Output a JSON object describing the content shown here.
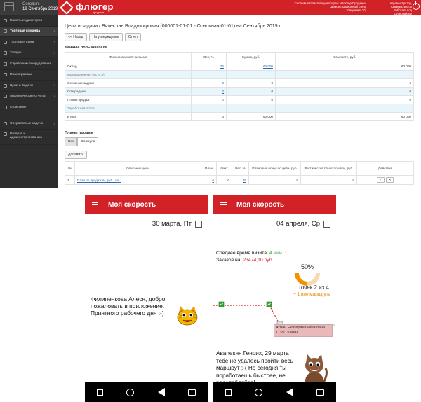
{
  "web": {
    "sidebar": {
      "today_label": "Сегодня:",
      "date": "19 Сентябрь 2019",
      "items": [
        {
          "label": "Панель индикаторов",
          "active": false,
          "arrow": false
        },
        {
          "label": "Торговая команда",
          "active": true,
          "arrow": true
        },
        {
          "label": "Торговые точки",
          "active": false,
          "arrow": true
        },
        {
          "label": "Товары",
          "active": false,
          "arrow": true
        },
        {
          "label": "Справочник оборудования",
          "active": false,
          "arrow": false
        },
        {
          "label": "Планограммы",
          "active": false,
          "arrow": false
        },
        {
          "label": "Цели и Задачи",
          "active": false,
          "arrow": true
        },
        {
          "label": "Аналитические отчеты",
          "active": false,
          "arrow": true
        },
        {
          "label": "О системе",
          "active": false,
          "arrow": false
        }
      ],
      "bottom_items": [
        {
          "label": "Оперативные задачи",
          "arrow": true
        },
        {
          "label": "Возврат к администрированию",
          "arrow": false
        }
      ]
    },
    "topbar": {
      "logo": "флюгер",
      "logo_sub": "продажи",
      "info_lines": [
        "Система автоматизации продаж «Флюгер-Продажи»",
        "Демонстрационный стенд",
        "(Лицензия: 10)"
      ],
      "user_lines": [
        "Администратор, Администратор",
        "Работает под",
        "Супервайзер",
        "Комаров Илья Сергеевич"
      ]
    },
    "page_title": "Цели и задачи / Вячеслав Владимирович (000001-01-01 - Основная-01-01) на Сентябрь 2019 г",
    "buttons": {
      "back": "<< Назад",
      "approve": "На утверждение",
      "report": "Отчет"
    },
    "section1_title": "Данные пользователя",
    "t1_headers": [
      "Фиксированная часть з/п",
      "Вес, %",
      "Сумма, руб.",
      "К выплате, руб."
    ],
    "t1_rows": [
      {
        "name": "Оклад",
        "weight": "75",
        "sum": "60 000",
        "pay": "60 000",
        "type": "normal",
        "links": true
      },
      {
        "name": "Мотивационная часть з/п",
        "weight": "",
        "sum": "",
        "pay": "",
        "type": "group",
        "links": false
      },
      {
        "name": "Основные задачи",
        "weight": "0",
        "sum": "0",
        "pay": "0",
        "type": "normal",
        "links": "weight"
      },
      {
        "name": "Спецзадачи",
        "weight": "0",
        "sum": "0",
        "pay": "0",
        "type": "hl",
        "links": "weight"
      },
      {
        "name": "Планы продаж",
        "weight": "0",
        "sum": "0",
        "pay": "0",
        "type": "normal",
        "links": "weight"
      },
      {
        "name": "Заработная плата",
        "weight": "",
        "sum": "",
        "pay": "",
        "type": "group",
        "links": false
      },
      {
        "name": "Итого",
        "weight": "0",
        "sum": "60 000",
        "pay": "60 000",
        "type": "normal",
        "links": false
      }
    ],
    "section2_title": "Планы продаж",
    "tabs": [
      "Вес",
      "Формула"
    ],
    "add_button": "Добавить",
    "t2_headers": [
      "№",
      "Описание цели",
      "План",
      "Факт",
      "Вес, %",
      "Плановый бонус по цели, руб.",
      "Фактический бонус по цели, руб.",
      "Действия"
    ],
    "t2_rows": [
      {
        "n": "1",
        "desc": "План по продажам, руб., на...",
        "plan": "0",
        "fact": "0",
        "weight": "25",
        "pbonus": "0",
        "fbonus": "0"
      }
    ],
    "action_icons": [
      "✓",
      "✕"
    ]
  },
  "phone1": {
    "title": "Моя скорость",
    "date": "30 марта, Пт",
    "message": "Филипенкова Алеся, добро пожаловать в приложение. Приятного рабочего дня :-)"
  },
  "phone2": {
    "title": "Моя скорость",
    "date": "04 апреля, Ср",
    "avg_visit_label": "Среднее время визита:",
    "avg_visit_value": "4 мин. ↑",
    "orders_label": "Заказов на:",
    "orders_value": "23474,10 руб. ↓",
    "progress": 0.5,
    "progress_label": "50%",
    "points": "точек 2 из 4",
    "off_route": "+ 1 вне маршрута",
    "tooltip_name": "Атнан Екатерина Ивановна",
    "tooltip_time": "11:21, 5 мин",
    "message": "Авanesян Генрих, 29 марта тебе не удалось пройти весь маршрут :-( Но сегодня ты поработаешь быстрее, не расслабляйся!"
  },
  "colors": {
    "brand_red": "#d22227",
    "sidebar": "#2d2d2d",
    "gauge_orange": "#f39200",
    "route_green": "#3aa53a"
  }
}
